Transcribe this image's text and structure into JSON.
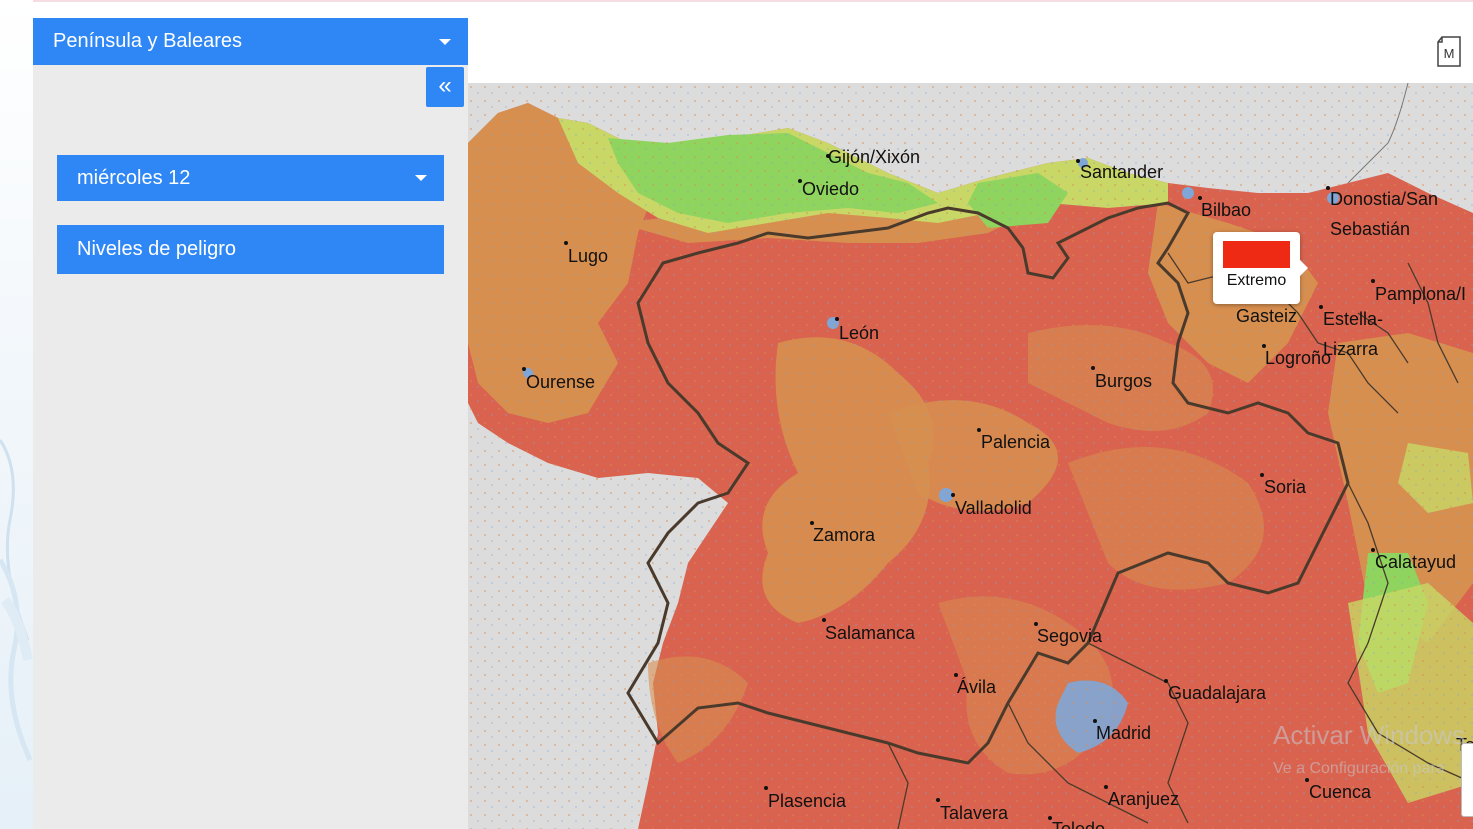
{
  "region_select": {
    "label": "Península y Baleares",
    "icon": "chevron-down-icon"
  },
  "sidebar": {
    "collapse_label": "«",
    "day_select": {
      "label": "miércoles 12",
      "icon": "chevron-down-icon"
    },
    "levels_button": "Niveles de peligro"
  },
  "toolbar": {
    "doc_icon_letter": "M"
  },
  "tooltip": {
    "label": "Extremo",
    "color": "#ef2a14"
  },
  "map": {
    "cities": [
      {
        "name": "Gijón/Xixón"
      },
      {
        "name": "Oviedo"
      },
      {
        "name": "Santander"
      },
      {
        "name": "Bilbao"
      },
      {
        "name": "Donostia/San"
      },
      {
        "name": "Sebastián"
      },
      {
        "name": "Lugo"
      },
      {
        "name": "Pamplona/I"
      },
      {
        "name": "Gasteiz"
      },
      {
        "name": "Estella-"
      },
      {
        "name": "Lizarra"
      },
      {
        "name": "León"
      },
      {
        "name": "Logroño"
      },
      {
        "name": "Ourense"
      },
      {
        "name": "Burgos"
      },
      {
        "name": "Palencia"
      },
      {
        "name": "Soria"
      },
      {
        "name": "Valladolid"
      },
      {
        "name": "Zamora"
      },
      {
        "name": "Calatayud"
      },
      {
        "name": "Salamanca"
      },
      {
        "name": "Segovia"
      },
      {
        "name": "Ávila"
      },
      {
        "name": "Guadalajara"
      },
      {
        "name": "Madrid"
      },
      {
        "name": "Plasencia"
      },
      {
        "name": "Talavera"
      },
      {
        "name": "Aranjuez"
      },
      {
        "name": "Cuenca"
      },
      {
        "name": "Toledo"
      },
      {
        "name": "Te"
      }
    ],
    "risk_colors": {
      "extreme": "#d9634e",
      "very_high": "#d78f50",
      "high": "#d4b24c",
      "moderate": "#c8d766",
      "low": "#8fd45e",
      "water": "#7fa6d6"
    }
  },
  "watermark": {
    "line1": "Activar Windows",
    "line2": "Ve a Configuración para"
  }
}
